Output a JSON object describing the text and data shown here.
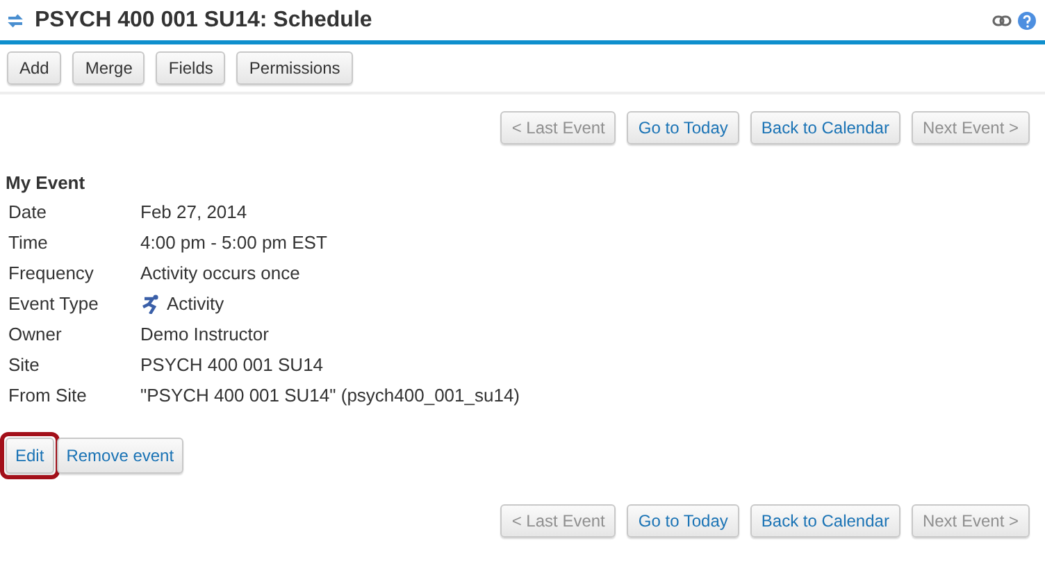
{
  "window": {
    "title": "PSYCH 400 001 SU14: Schedule"
  },
  "toolbar": [
    {
      "label": "Add"
    },
    {
      "label": "Merge"
    },
    {
      "label": "Fields"
    },
    {
      "label": "Permissions"
    }
  ],
  "nav_top": [
    {
      "label": "< Last Event",
      "disabled": true
    },
    {
      "label": "Go to Today",
      "disabled": false
    },
    {
      "label": "Back to Calendar",
      "disabled": false
    },
    {
      "label": "Next Event >",
      "disabled": true
    }
  ],
  "event": {
    "heading": "My Event",
    "fields": [
      {
        "label": "Date",
        "value": "Feb 27, 2014"
      },
      {
        "label": "Time",
        "value": "4:00 pm - 5:00 pm EST"
      },
      {
        "label": "Frequency",
        "value": "Activity occurs once"
      },
      {
        "label": "Event Type",
        "value": "Activity",
        "kind": "type"
      },
      {
        "label": "Owner",
        "value": "Demo Instructor"
      },
      {
        "label": "Site",
        "value": "PSYCH 400 001 SU14"
      },
      {
        "label": "From Site",
        "value": "\"PSYCH 400 001 SU14\" (psych400_001_su14)"
      }
    ]
  },
  "actions": [
    {
      "label": "Edit",
      "highlighted": true
    },
    {
      "label": "Remove event",
      "highlighted": false
    }
  ],
  "nav_bottom": [
    {
      "label": "< Last Event",
      "disabled": true
    },
    {
      "label": "Go to Today",
      "disabled": false
    },
    {
      "label": "Back to Calendar",
      "disabled": false
    },
    {
      "label": "Next Event >",
      "disabled": true
    }
  ]
}
